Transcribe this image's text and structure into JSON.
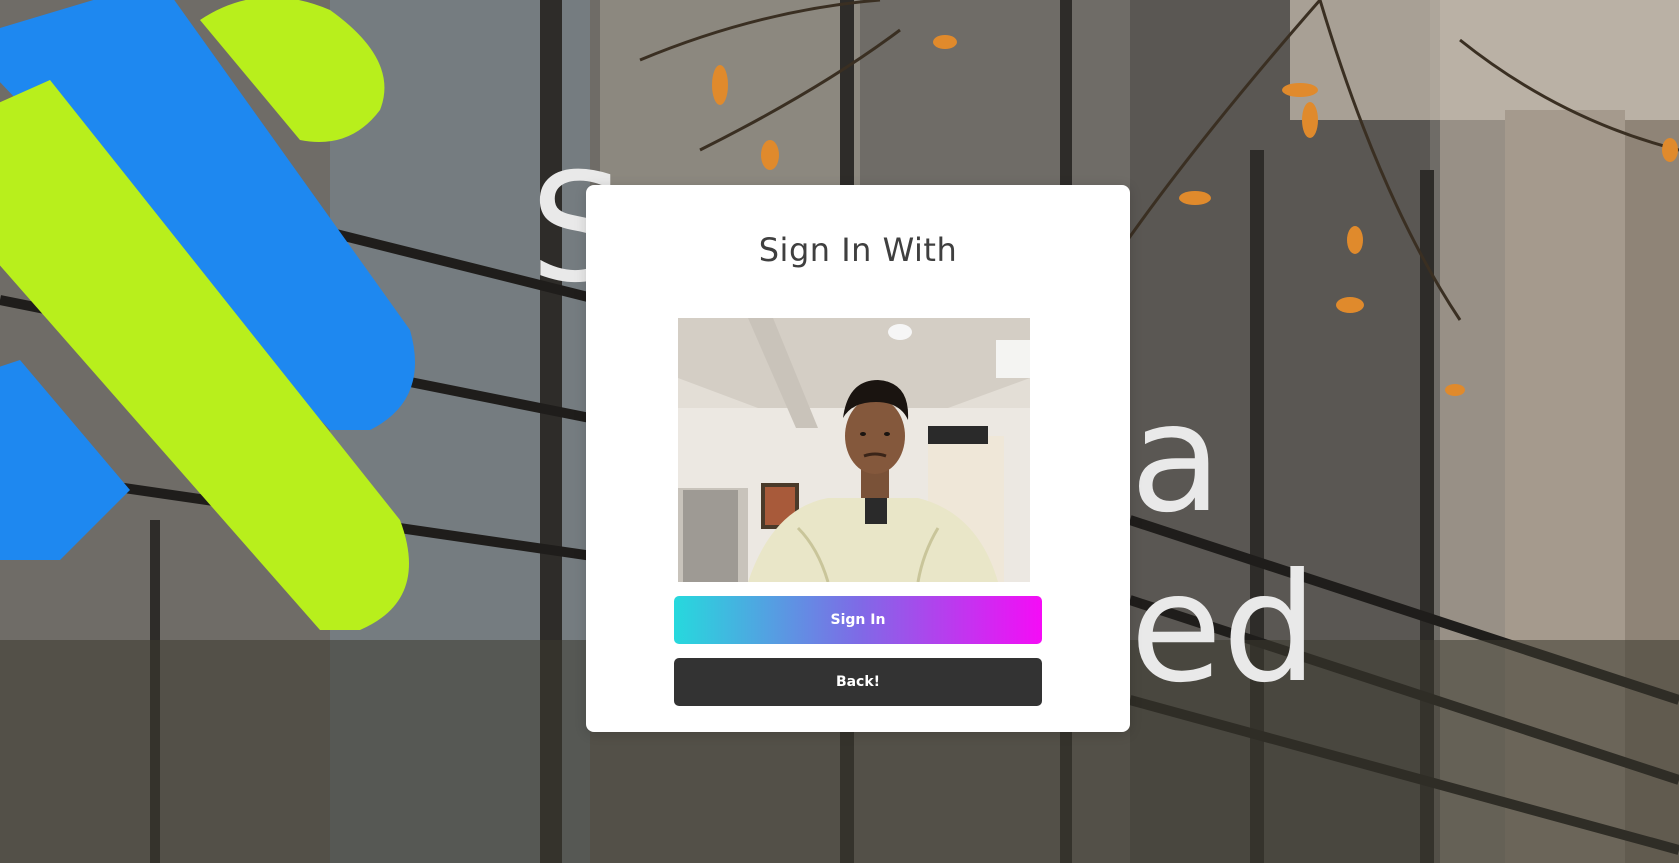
{
  "modal": {
    "title": "Sign In With",
    "signin_label": "Sign In",
    "back_label": "Back!"
  },
  "colors": {
    "signin_gradient_start": "#26d9dd",
    "signin_gradient_end": "#f50cf6",
    "back_button": "#333333",
    "card_background": "#ffffff",
    "title_text": "#3f3f3f",
    "logo_blue": "#1e88f0",
    "logo_green": "#b8ef1c"
  },
  "icons": {
    "camera_preview": "webcam-feed"
  }
}
